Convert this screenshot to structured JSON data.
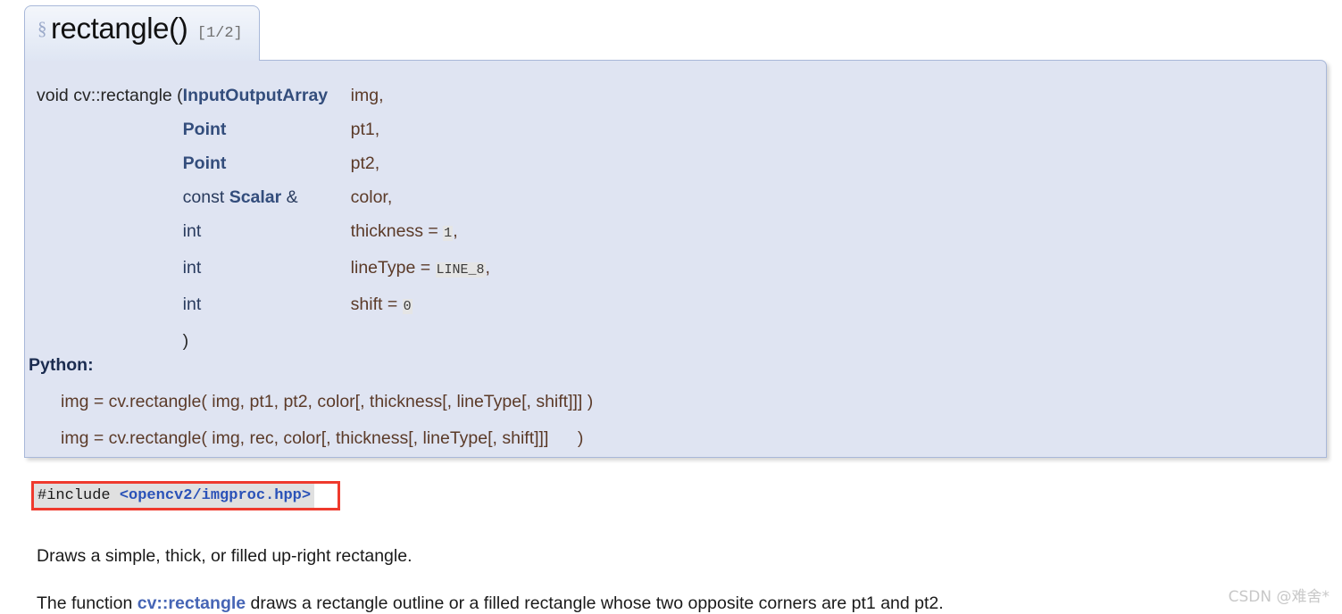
{
  "header": {
    "permalink_glyph": "§",
    "title": "rectangle()",
    "overload_count": "[1/2]"
  },
  "signature": {
    "return_and_name": "void cv::rectangle (",
    "close_paren": ")",
    "params": [
      {
        "type_prefix": "",
        "type": "InputOutputArray",
        "type_suffix": "",
        "name": "img,",
        "default": "",
        "default_sep": ""
      },
      {
        "type_prefix": "",
        "type": "Point",
        "type_suffix": "",
        "name": "pt1,",
        "default": "",
        "default_sep": ""
      },
      {
        "type_prefix": "",
        "type": "Point",
        "type_suffix": "",
        "name": "pt2,",
        "default": "",
        "default_sep": ""
      },
      {
        "type_prefix": "const ",
        "type": "Scalar",
        "type_suffix": " &",
        "name": "color,",
        "default": "",
        "default_sep": ""
      },
      {
        "type_prefix": "",
        "type": "",
        "type_suffix": "int",
        "name": "thickness = ",
        "default": "1",
        "default_sep": ","
      },
      {
        "type_prefix": "",
        "type": "",
        "type_suffix": "int",
        "name": "lineType = ",
        "default": "LINE_8",
        "default_sep": ","
      },
      {
        "type_prefix": "",
        "type": "",
        "type_suffix": "int",
        "name": "shift = ",
        "default": "0",
        "default_sep": ""
      }
    ]
  },
  "python": {
    "label": "Python:",
    "lines": [
      "img = cv.rectangle( img, pt1, pt2, color[, thickness[, lineType[, shift]]] )",
      "img = cv.rectangle( img, rec, color[, thickness[, lineType[, shift]]]      )"
    ]
  },
  "include": {
    "directive": "#include ",
    "path": "<opencv2/imgproc.hpp>"
  },
  "description": {
    "line1": "Draws a simple, thick, or filled up-right rectangle.",
    "line2_before": "The function ",
    "line2_code": "cv::rectangle",
    "line2_after": " draws a rectangle outline or a filled rectangle whose two opposite corners are pt1 and pt2."
  },
  "watermark": "CSDN @难舍*",
  "colors": {
    "panel_bg": "#dfe4f2",
    "panel_border": "#a8b8d9",
    "type_blue": "#334d7c",
    "param_brown": "#5b3a28",
    "annotation_red": "#ef3a2d",
    "include_path_blue": "#2a52b8"
  }
}
